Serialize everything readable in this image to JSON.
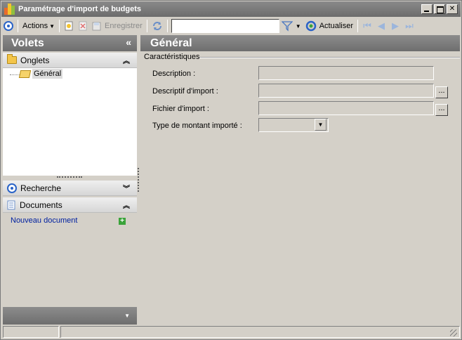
{
  "window": {
    "title": "Paramétrage d'import de budgets"
  },
  "toolbar": {
    "actions_label": "Actions",
    "save_label": "Enregistrer",
    "search_value": "",
    "refresh_label": "Actualiser"
  },
  "left_panel": {
    "title": "Volets",
    "sections": {
      "tabs_title": "Onglets",
      "tree_items": [
        "Général"
      ],
      "search_title": "Recherche",
      "documents_title": "Documents",
      "new_document_label": "Nouveau document"
    }
  },
  "main": {
    "title": "Général",
    "group_label": "Caractéristiques",
    "fields": [
      {
        "label": "Description :",
        "value": ""
      },
      {
        "label": "Descriptif d'import :",
        "value": ""
      },
      {
        "label": "Fichier d'import :",
        "value": ""
      },
      {
        "label": "Type de montant importé :",
        "value": ""
      }
    ],
    "browse_label": "..."
  },
  "icons": {
    "actions": "target-ring-icon",
    "new": "new-document-icon",
    "delete": "delete-icon",
    "save": "save-icon",
    "sync": "sync-icon",
    "filter": "filter-icon",
    "refresh": "refresh-icon",
    "first": "first-record-icon",
    "prev": "previous-record-icon",
    "next": "next-record-icon",
    "last": "last-record-icon"
  },
  "colors": {
    "header_gradient_top": "#8c8c8c",
    "header_gradient_bottom": "#6e6e6e",
    "accent_blue": "#2a63c7",
    "link_blue": "#0020a0"
  }
}
